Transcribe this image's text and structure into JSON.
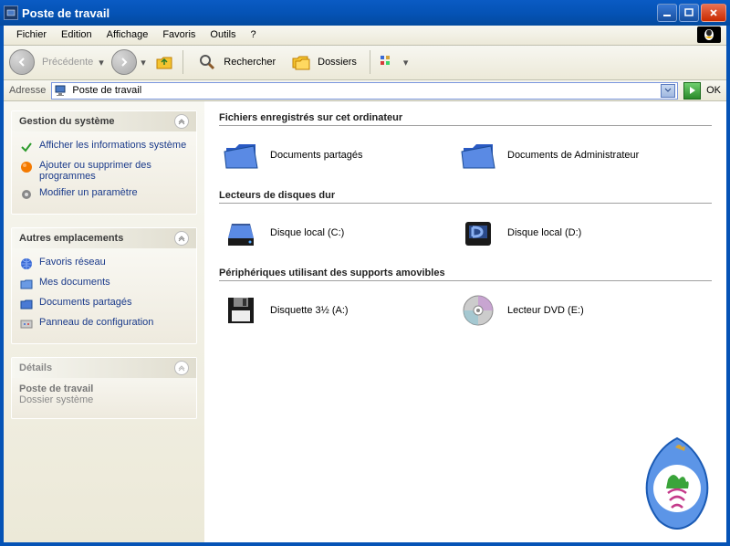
{
  "window": {
    "title": "Poste de travail"
  },
  "menus": [
    "Fichier",
    "Edition",
    "Affichage",
    "Favoris",
    "Outils",
    "?"
  ],
  "toolbar": {
    "back_label": "Précédente",
    "search_label": "Rechercher",
    "folders_label": "Dossiers"
  },
  "address": {
    "label": "Adresse",
    "value": "Poste de travail",
    "ok": "OK"
  },
  "sidebar": {
    "panel1": {
      "title": "Gestion du système",
      "items": [
        {
          "icon": "check-green",
          "label": "Afficher les informations système"
        },
        {
          "icon": "circle-orange",
          "label": "Ajouter ou supprimer des programmes"
        },
        {
          "icon": "gear",
          "label": "Modifier un paramètre"
        }
      ]
    },
    "panel2": {
      "title": "Autres emplacements",
      "items": [
        {
          "icon": "globe",
          "label": "Favoris réseau"
        },
        {
          "icon": "folder-doc",
          "label": "Mes documents"
        },
        {
          "icon": "folder-shared",
          "label": "Documents partagés"
        },
        {
          "icon": "panel",
          "label": "Panneau de configuration"
        }
      ]
    },
    "panel3": {
      "title": "Détails",
      "details_title": "Poste de travail",
      "details_sub": "Dossier système"
    }
  },
  "main": {
    "sections": [
      {
        "title": "Fichiers enregistrés sur cet ordinateur",
        "items": [
          {
            "icon": "folder-shared-big",
            "label": "Documents partagés"
          },
          {
            "icon": "folder-shared-big",
            "label": "Documents de Administrateur"
          }
        ]
      },
      {
        "title": "Lecteurs de disques dur",
        "items": [
          {
            "icon": "hdd",
            "label": "Disque local (C:)"
          },
          {
            "icon": "hdd-alt",
            "label": "Disque local (D:)"
          }
        ]
      },
      {
        "title": "Périphériques utilisant des supports amovibles",
        "items": [
          {
            "icon": "floppy",
            "label": "Disquette 3½ (A:)"
          },
          {
            "icon": "dvd",
            "label": "Lecteur DVD (E:)"
          }
        ]
      }
    ]
  }
}
